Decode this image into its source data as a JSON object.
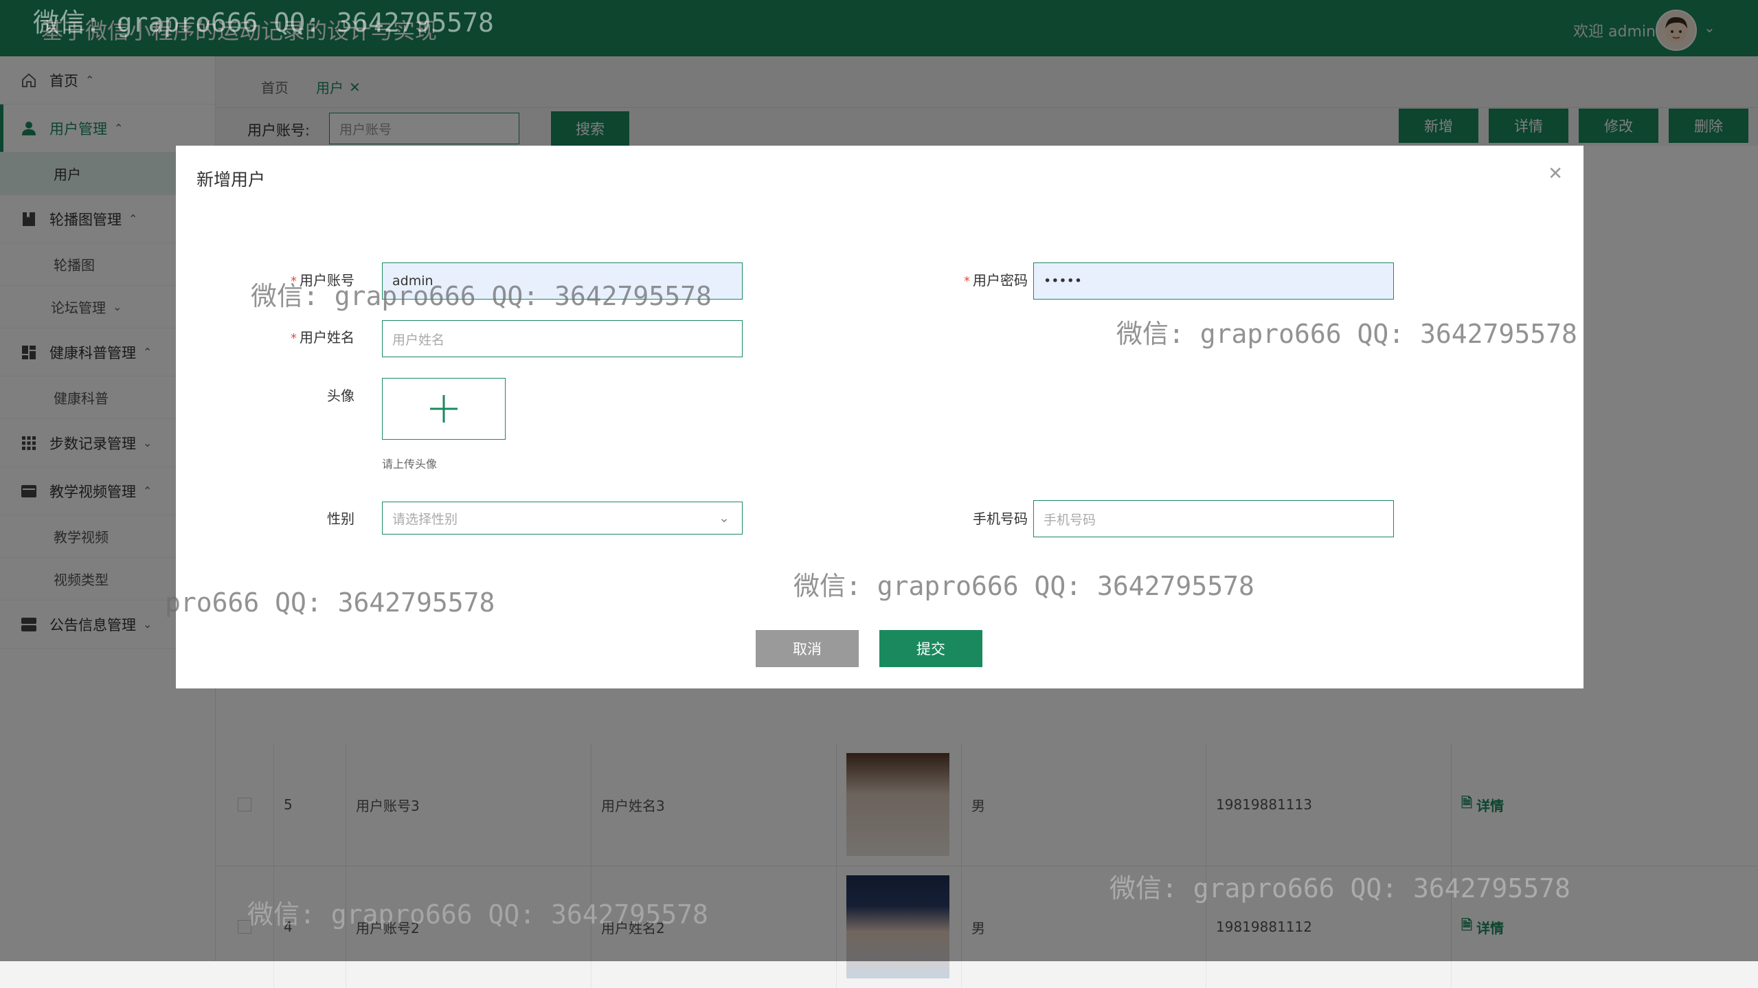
{
  "header": {
    "title": "基于微信小程序的运动记录的设计与实现",
    "welcome": "欢迎 admin"
  },
  "sidebar": {
    "items": [
      {
        "label": "首页"
      },
      {
        "label": "用户管理"
      },
      {
        "label": "用户"
      },
      {
        "label": "轮播图管理"
      },
      {
        "label": "轮播图"
      },
      {
        "label": "论坛管理"
      },
      {
        "label": "健康科普管理"
      },
      {
        "label": "健康科普"
      },
      {
        "label": "步数记录管理"
      },
      {
        "label": "教学视频管理"
      },
      {
        "label": "教学视频"
      },
      {
        "label": "视频类型"
      },
      {
        "label": "公告信息管理"
      }
    ]
  },
  "breadcrumb": {
    "home": "首页",
    "current": "用户"
  },
  "search": {
    "label": "用户账号:",
    "placeholder": "用户账号",
    "button": "搜索"
  },
  "toolbar": {
    "add": "新增",
    "detail": "详情",
    "edit": "修改",
    "delete": "删除"
  },
  "table": {
    "rows": [
      {
        "id": "5",
        "account": "用户账号3",
        "name": "用户姓名3",
        "gender": "男",
        "phone": "19819881113",
        "action": "详情"
      },
      {
        "id": "4",
        "account": "用户账号2",
        "name": "用户姓名2",
        "gender": "男",
        "phone": "19819881112",
        "action": "详情"
      }
    ]
  },
  "dialog": {
    "title": "新增用户",
    "fields": {
      "account": {
        "label": "用户账号",
        "value": "admin"
      },
      "password": {
        "label": "用户密码",
        "value": "•••••"
      },
      "realname": {
        "label": "用户姓名",
        "placeholder": "用户姓名"
      },
      "avatar": {
        "label": "头像",
        "tip": "请上传头像"
      },
      "gender": {
        "label": "性别",
        "placeholder": "请选择性别"
      },
      "phone": {
        "label": "手机号码",
        "placeholder": "手机号码"
      }
    },
    "cancel": "取消",
    "submit": "提交"
  },
  "watermarks": [
    "微信: grapro666 QQ: 3642795578",
    "微信: grapro666 QQ: 3642795578",
    "微信: grapro666 QQ: 3642795578",
    "微信: grapro666 QQ: 3642795578",
    "pro666 QQ: 3642795578",
    "微信: grapro666 QQ: 3642795578",
    "微信: grapro666 QQ: 3642795578"
  ],
  "colors": {
    "accent": "#1a8a5e",
    "cancel": "#9a9a9a"
  }
}
